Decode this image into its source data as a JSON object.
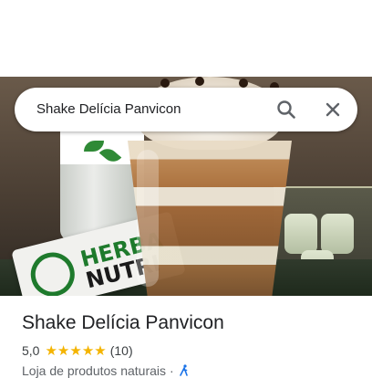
{
  "search": {
    "query": "Shake Delícia Panvicon"
  },
  "place": {
    "title": "Shake Delícia Panvicon",
    "rating": "5,0",
    "stars": 5,
    "review_count": "(10)",
    "category": "Loja de produtos naturais",
    "separator": "·"
  },
  "photo": {
    "towel_text_line1": "HERBA",
    "towel_text_line2": "NUTRI"
  },
  "colors": {
    "star": "#f4b400",
    "herbalife_green": "#1e7a2c",
    "text_primary": "#202124",
    "text_secondary": "#5f6368",
    "icon_gray": "#5f6368",
    "accessibility_blue": "#1a73e8"
  },
  "icons": {
    "search": "search-icon",
    "close": "close-icon",
    "star": "star-icon",
    "accessibility": "walking-person-icon"
  }
}
